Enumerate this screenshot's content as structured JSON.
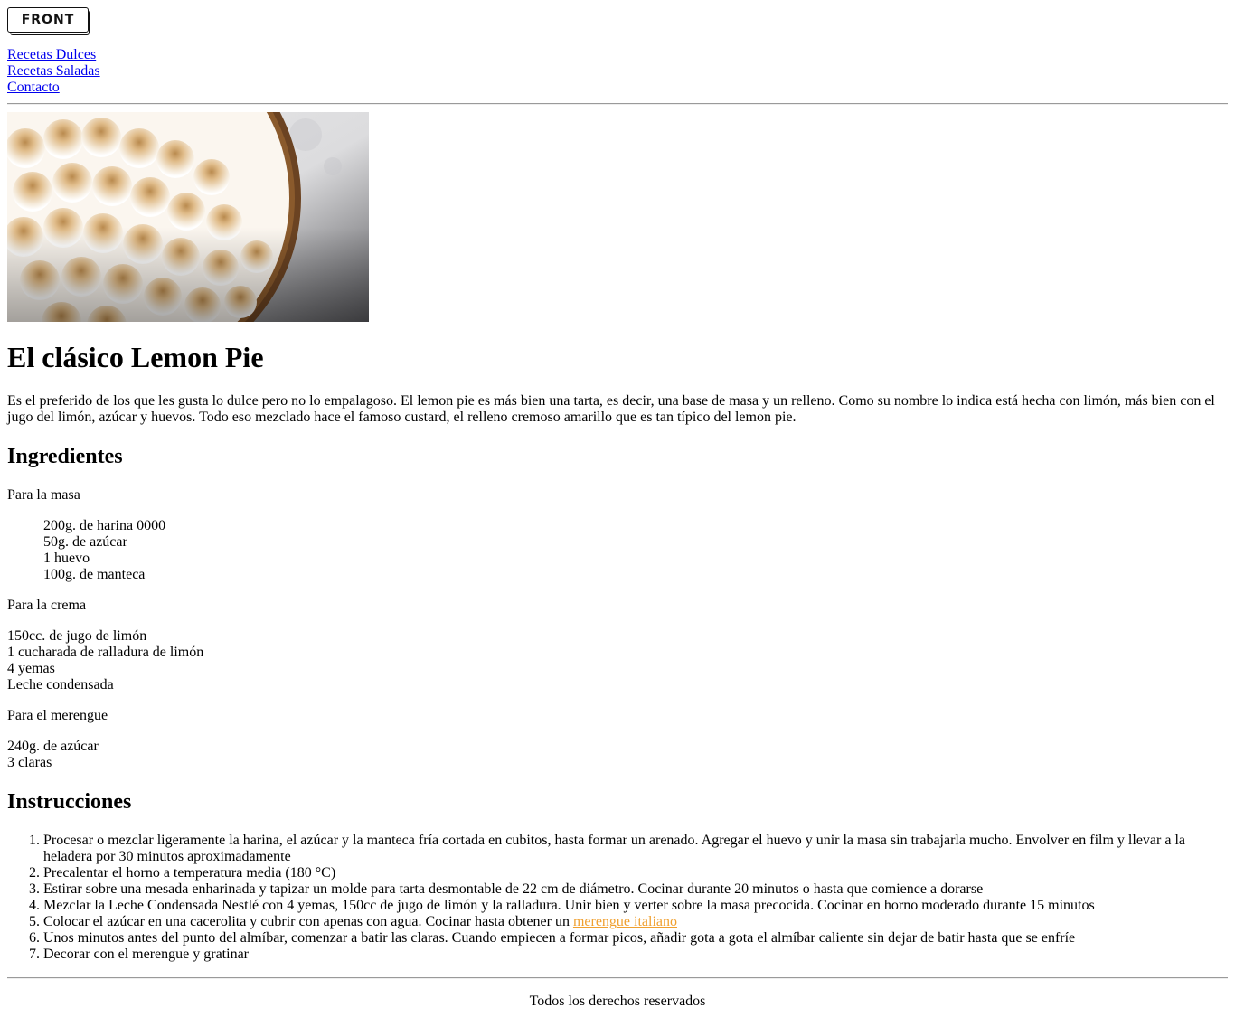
{
  "logo": {
    "text": "FRONT"
  },
  "nav": [
    {
      "label": "Recetas Dulces"
    },
    {
      "label": "Recetas Saladas"
    },
    {
      "label": "Contacto"
    }
  ],
  "article": {
    "title": "El clásico Lemon Pie",
    "intro": "Es el preferido de los que les gusta lo dulce pero no lo empalagoso. El lemon pie es más bien una tarta, es decir, una base de masa y un relleno. Como su nombre lo indica está hecha con limón, más bien con el jugo del limón, azúcar y huevos. Todo eso mezclado hace el famoso custard, el relleno cremoso amarillo que es tan típico del lemon pie.",
    "ingredients_heading": "Ingredientes",
    "groups": [
      {
        "title": "Para la masa",
        "items": [
          "200g. de harina 0000",
          "50g. de azúcar",
          "1 huevo",
          "100g. de manteca"
        ]
      },
      {
        "title": "Para la crema",
        "items": [
          "150cc. de jugo de limón",
          "1 cucharada de ralladura de limón",
          "4 yemas",
          "Leche condensada"
        ]
      },
      {
        "title": "Para el merengue",
        "items": [
          "240g. de azúcar",
          "3 claras"
        ]
      }
    ],
    "instructions_heading": "Instrucciones",
    "steps": [
      "Procesar o mezclar ligeramente la harina, el azúcar y la manteca fría cortada en cubitos, hasta formar un arenado. Agregar el huevo y unir la masa sin trabajarla mucho. Envolver en film y llevar a la heladera por 30 minutos aproximadamente",
      "Precalentar el horno a temperatura media (180 °C)",
      "Estirar sobre una mesada enharinada y tapizar un molde para tarta desmontable de 22 cm de diámetro. Cocinar durante 20 minutos o hasta que comience a dorarse",
      "Mezclar la Leche Condensada Nestlé con 4 yemas, 150cc de jugo de limón y la ralladura. Unir bien y verter sobre la masa precocida. Cocinar en horno moderado durante 15 minutos"
    ],
    "step5": {
      "before": "Colocar el azúcar en una cacerolita y cubrir con apenas con agua. Cocinar hasta obtener un ",
      "link": "merengue italiano"
    },
    "steps_after": [
      "Unos minutos antes del punto del almíbar, comenzar a batir las claras. Cuando empiecen a formar picos, añadir gota a gota el almíbar caliente sin dejar de batir hasta que se enfríe",
      "Decorar con el merengue y gratinar"
    ]
  },
  "footer": {
    "text": "Todos los derechos reservados"
  },
  "colors": {
    "link": "#0000ee",
    "accent_link": "#f0a030"
  }
}
